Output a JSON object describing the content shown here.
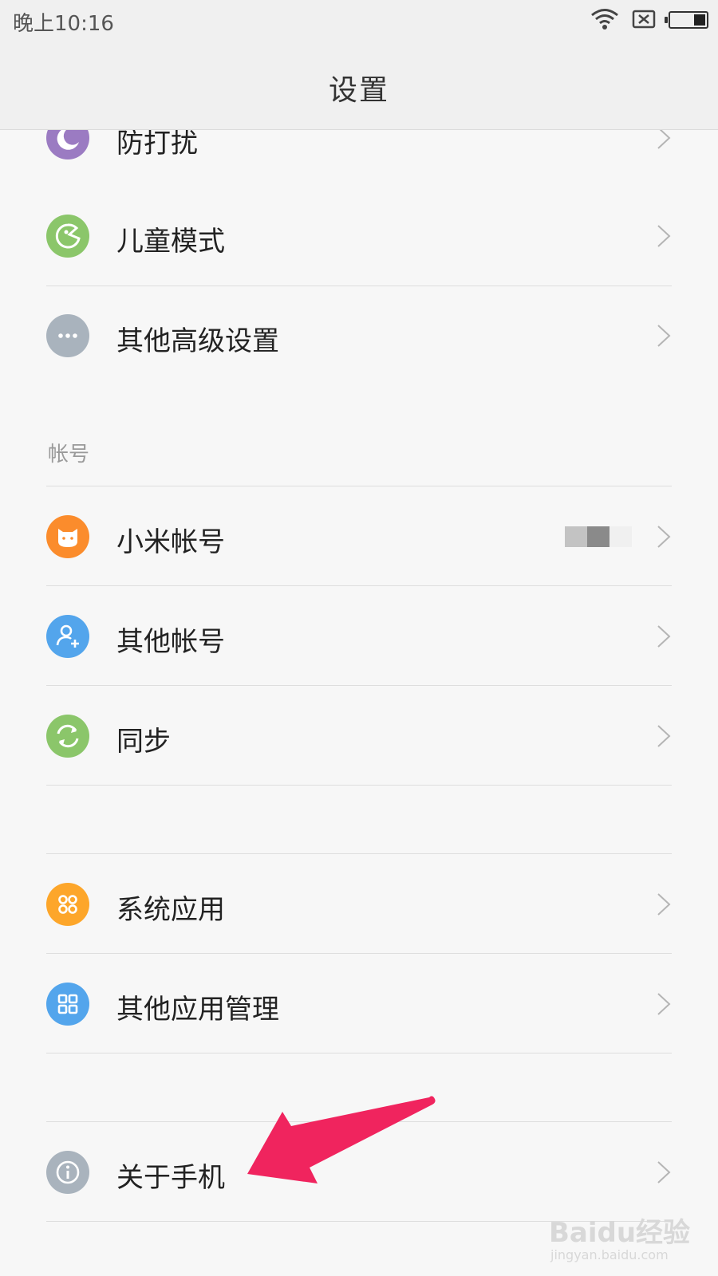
{
  "status_bar": {
    "time": "晚上10:16"
  },
  "header": {
    "title": "设置"
  },
  "settings": {
    "dnd": {
      "label": "防打扰",
      "icon": "moon-icon",
      "color": "#9b7bc2"
    },
    "kids": {
      "label": "儿童模式",
      "icon": "kids-face-icon",
      "color": "#8bc66a"
    },
    "advanced": {
      "label": "其他高级设置",
      "icon": "more-dots-icon",
      "color": "#a9b3bd"
    }
  },
  "accounts_section": {
    "header": "帐号",
    "mi_account": {
      "label": "小米帐号",
      "icon": "mi-bunny-icon",
      "color": "#fb8c2c"
    },
    "other_accounts": {
      "label": "其他帐号",
      "icon": "add-person-icon",
      "color": "#53a5ec"
    },
    "sync": {
      "label": "同步",
      "icon": "sync-icon",
      "color": "#8bc66a"
    }
  },
  "apps_section": {
    "system_apps": {
      "label": "系统应用",
      "icon": "apps-grid-icon",
      "color": "#fda62a"
    },
    "other_apps": {
      "label": "其他应用管理",
      "icon": "apps-grid-icon",
      "color": "#53a5ec"
    }
  },
  "about_section": {
    "about_phone": {
      "label": "关于手机",
      "icon": "info-icon",
      "color": "#a9b3bd"
    }
  },
  "annotation": {
    "arrow_color": "#f0245e"
  },
  "watermark": {
    "main": "Baidu经验",
    "sub": "jingyan.baidu.com"
  }
}
